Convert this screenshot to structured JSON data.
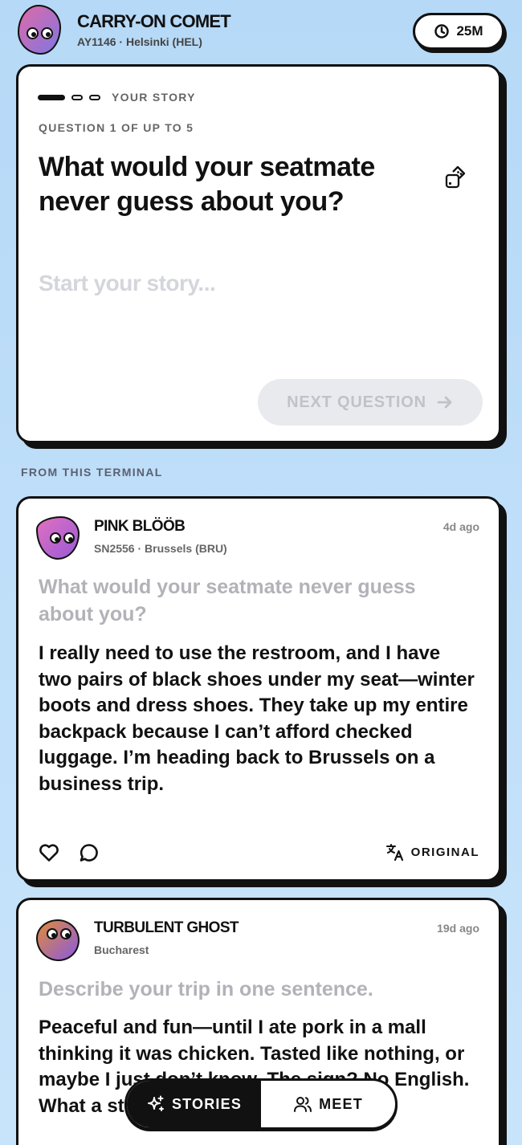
{
  "header": {
    "title": "CARRY-ON COMET",
    "subtitle": "AY1146 · Helsinki (HEL)",
    "timer": "25M",
    "avatar_colors": [
      "#e06aa8",
      "#7f76e0"
    ]
  },
  "composer": {
    "section_label": "YOUR STORY",
    "progress": {
      "current": 1,
      "steps": 3
    },
    "question_counter": "QUESTION 1 OF UP TO 5",
    "question": "What would your seatmate never guess about you?",
    "placeholder": "Start your story...",
    "next_button": "NEXT QUESTION"
  },
  "feed": {
    "section_label": "FROM THIS TERMINAL",
    "stories": [
      {
        "name": "PINK BLÖÖB",
        "meta": "SN2556 · Brussels (BRU)",
        "time": "4d ago",
        "question": "What would your seatmate never guess about you?",
        "answer": "I really need to use the restroom, and I have two pairs of black shoes under my seat—winter boots and dress shoes. They take up my entire backpack because I can’t afford checked luggage. I’m heading back to Brussels on a business trip.",
        "translate_label": "ORIGINAL",
        "avatar_colors": [
          "#e070c0",
          "#9a5ad8"
        ]
      },
      {
        "name": "TURBULENT GHOST",
        "meta": "Bucharest",
        "time": "19d ago",
        "question": "Describe your trip in one sentence.",
        "answer": "Peaceful and fun—until I ate pork in a mall thinking it was chicken. Tasted like nothing, or maybe I just don’t know. The sign? No English. What a story on this flight home.",
        "avatar_colors": [
          "#e08a3a",
          "#8a5ae0"
        ]
      }
    ]
  },
  "tabbar": {
    "tabs": [
      {
        "label": "STORIES",
        "active": true
      },
      {
        "label": "MEET",
        "active": false
      }
    ]
  }
}
